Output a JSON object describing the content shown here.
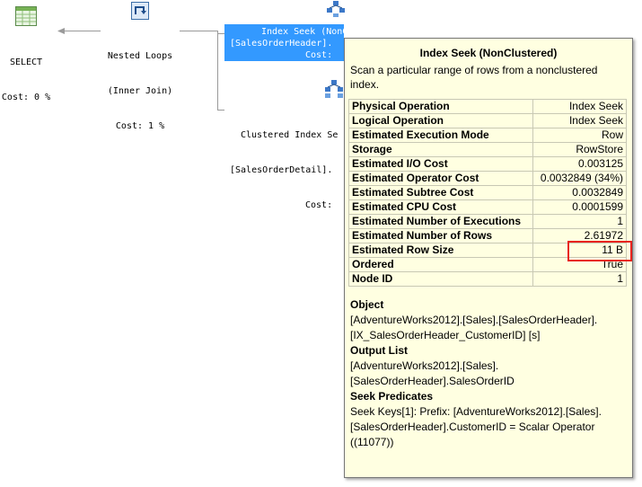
{
  "plan": {
    "select_node": {
      "label": "SELECT",
      "cost": "Cost: 0 %"
    },
    "nested_loops_node": {
      "name": "Nested Loops",
      "type": "(Inner Join)",
      "cost": "Cost: 1 %"
    },
    "index_seek_node": {
      "name": "Index Seek (NonClustered)",
      "object": "[SalesOrderHeader].",
      "cost": "Cost:"
    },
    "clustered_node": {
      "name": "Clustered Index Se",
      "object": "[SalesOrderDetail].",
      "cost": "Cost:"
    }
  },
  "tooltip": {
    "title": "Index Seek (NonClustered)",
    "description": "Scan a particular range of rows from a nonclustered index.",
    "properties": [
      {
        "key": "Physical Operation",
        "value": "Index Seek"
      },
      {
        "key": "Logical Operation",
        "value": "Index Seek"
      },
      {
        "key": "Estimated Execution Mode",
        "value": "Row"
      },
      {
        "key": "Storage",
        "value": "RowStore"
      },
      {
        "key": "Estimated I/O Cost",
        "value": "0.003125"
      },
      {
        "key": "Estimated Operator Cost",
        "value": "0.0032849 (34%)"
      },
      {
        "key": "Estimated Subtree Cost",
        "value": "0.0032849"
      },
      {
        "key": "Estimated CPU Cost",
        "value": "0.0001599"
      },
      {
        "key": "Estimated Number of Executions",
        "value": "1"
      },
      {
        "key": "Estimated Number of Rows",
        "value": "2.61972"
      },
      {
        "key": "Estimated Row Size",
        "value": "11 B"
      },
      {
        "key": "Ordered",
        "value": "True"
      },
      {
        "key": "Node ID",
        "value": "1"
      }
    ],
    "object_heading": "Object",
    "object_line1": "[AdventureWorks2012].[Sales].[SalesOrderHeader].",
    "object_line2": "[IX_SalesOrderHeader_CustomerID] [s]",
    "output_heading": "Output List",
    "output_line1": "[AdventureWorks2012].[Sales].",
    "output_line2": "[SalesOrderHeader].SalesOrderID",
    "seek_heading": "Seek Predicates",
    "seek_line1": "Seek Keys[1]: Prefix: [AdventureWorks2012].[Sales].",
    "seek_line2": "[SalesOrderHeader].CustomerID = Scalar Operator",
    "seek_line3": "((11077))"
  },
  "colors": {
    "highlight": "#3399ff",
    "tooltip_bg": "#ffffe1",
    "annotation": "#e8241f"
  },
  "icons": [
    "select-table-icon",
    "nested-loops-icon",
    "index-seek-icon",
    "clustered-index-seek-icon"
  ]
}
